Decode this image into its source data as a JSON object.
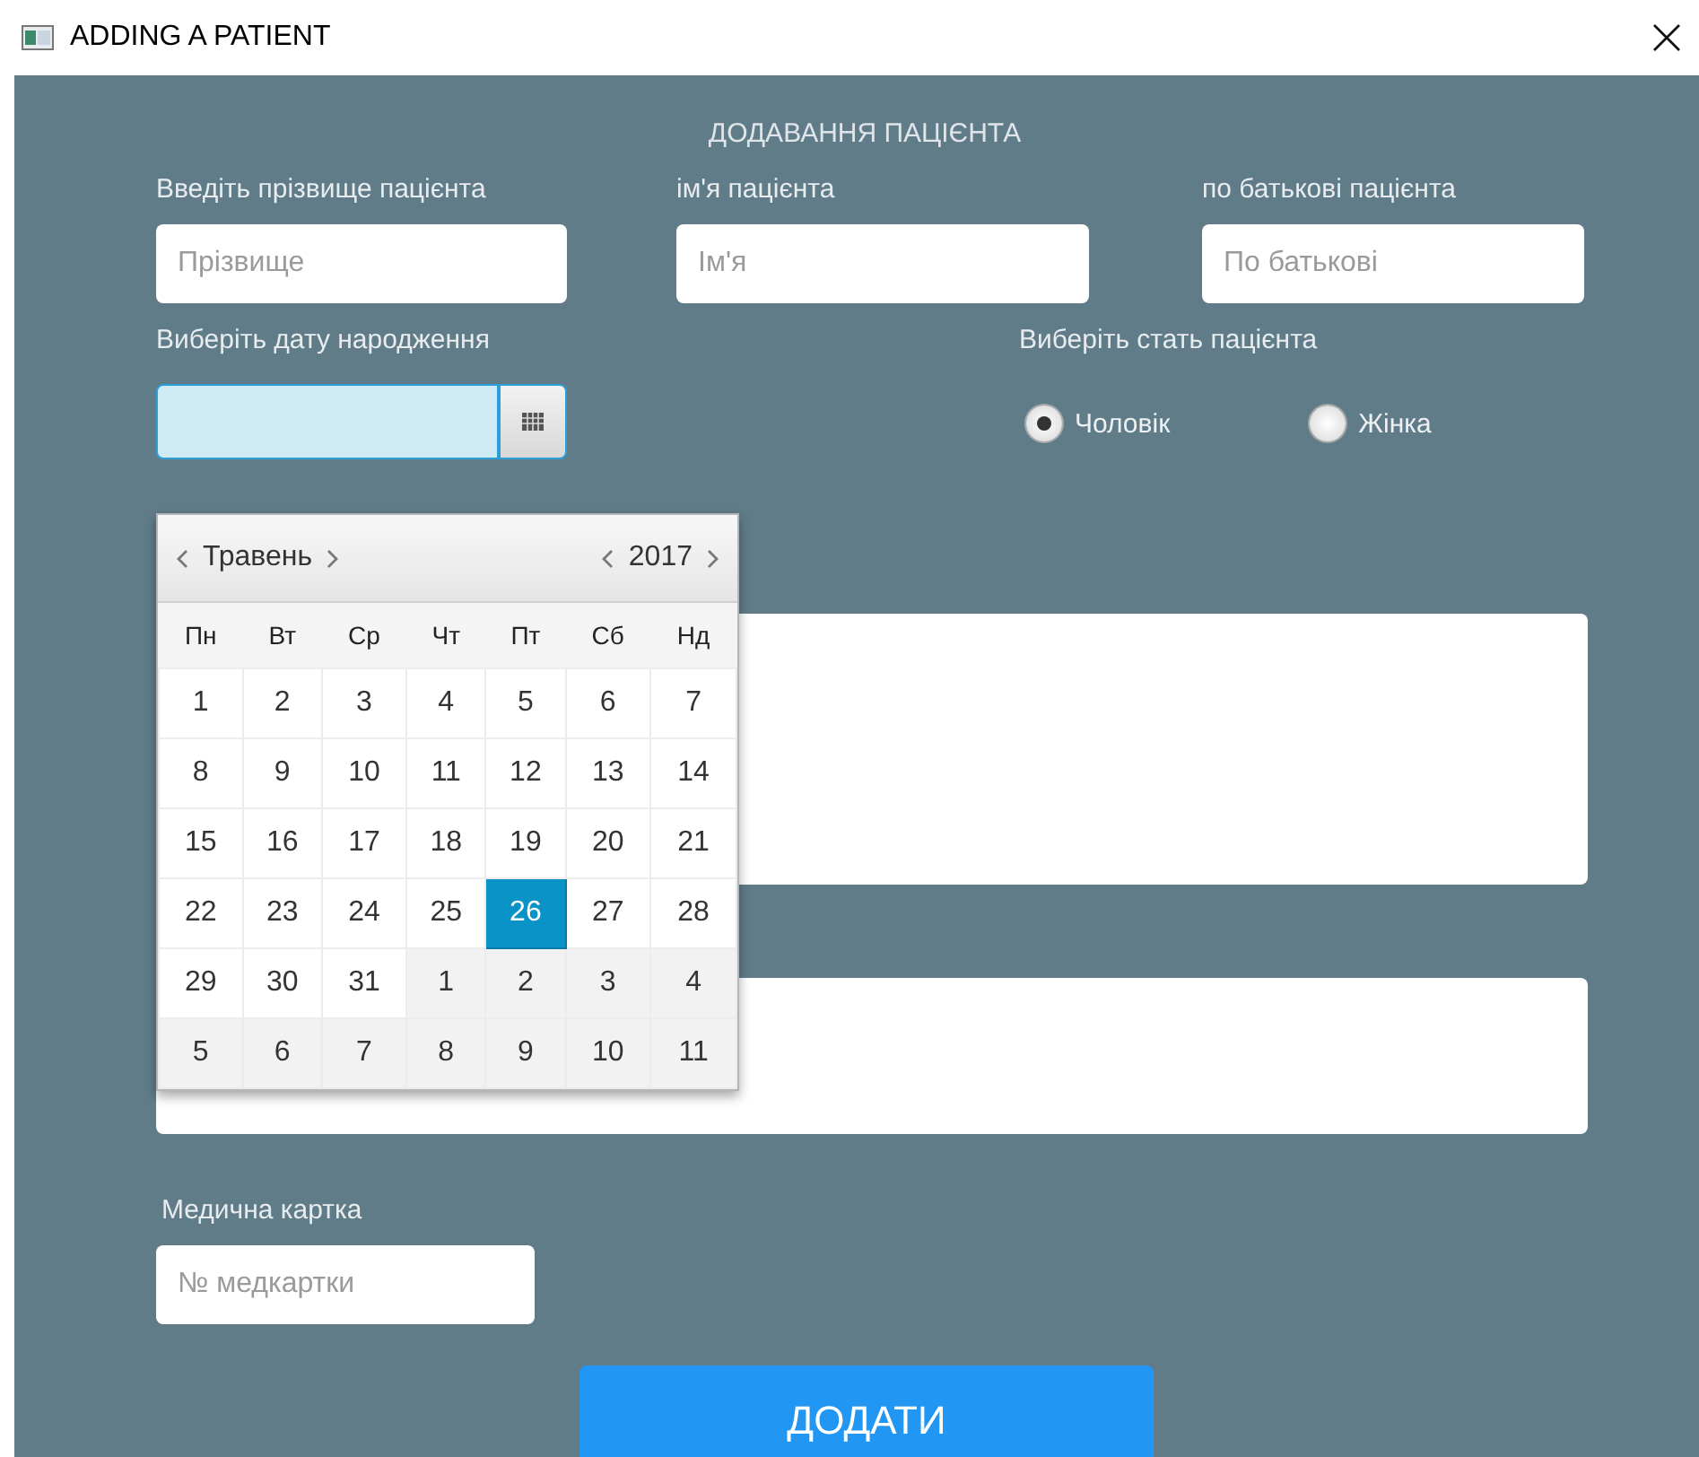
{
  "window": {
    "title": "ADDING A PATIENT"
  },
  "form": {
    "heading": "ДОДАВАННЯ ПАЦІЄНТА",
    "name_fields": [
      {
        "label": "Введіть прізвище пацієнта",
        "placeholder": "Прізвище"
      },
      {
        "label": "ім'я пацієнта",
        "placeholder": "Ім'я"
      },
      {
        "label": "по батькові пацієнта",
        "placeholder": "По батькові"
      }
    ],
    "birth_date": {
      "label": "Виберіть дату народження",
      "focused": true
    },
    "gender": {
      "label": "Виберіть стать пацієнта",
      "options": [
        {
          "label": "Чоловік",
          "selected": true
        },
        {
          "label": "Жінка",
          "selected": false
        }
      ]
    },
    "medical_card": {
      "label": "Медична картка",
      "placeholder": "№ медкартки"
    },
    "submit": "ДОДАТИ"
  },
  "calendar": {
    "month": "Травень",
    "year": "2017",
    "weekdays": [
      "Пн",
      "Вт",
      "Ср",
      "Чт",
      "Пт",
      "Сб",
      "Нд"
    ],
    "weeks": [
      [
        {
          "day": "1",
          "other_month": false,
          "selected": false
        },
        {
          "day": "2",
          "other_month": false,
          "selected": false
        },
        {
          "day": "3",
          "other_month": false,
          "selected": false
        },
        {
          "day": "4",
          "other_month": false,
          "selected": false
        },
        {
          "day": "5",
          "other_month": false,
          "selected": false
        },
        {
          "day": "6",
          "other_month": false,
          "selected": false
        },
        {
          "day": "7",
          "other_month": false,
          "selected": false
        }
      ],
      [
        {
          "day": "8",
          "other_month": false,
          "selected": false
        },
        {
          "day": "9",
          "other_month": false,
          "selected": false
        },
        {
          "day": "10",
          "other_month": false,
          "selected": false
        },
        {
          "day": "11",
          "other_month": false,
          "selected": false
        },
        {
          "day": "12",
          "other_month": false,
          "selected": false
        },
        {
          "day": "13",
          "other_month": false,
          "selected": false
        },
        {
          "day": "14",
          "other_month": false,
          "selected": false
        }
      ],
      [
        {
          "day": "15",
          "other_month": false,
          "selected": false
        },
        {
          "day": "16",
          "other_month": false,
          "selected": false
        },
        {
          "day": "17",
          "other_month": false,
          "selected": false
        },
        {
          "day": "18",
          "other_month": false,
          "selected": false
        },
        {
          "day": "19",
          "other_month": false,
          "selected": false
        },
        {
          "day": "20",
          "other_month": false,
          "selected": false
        },
        {
          "day": "21",
          "other_month": false,
          "selected": false
        }
      ],
      [
        {
          "day": "22",
          "other_month": false,
          "selected": false
        },
        {
          "day": "23",
          "other_month": false,
          "selected": false
        },
        {
          "day": "24",
          "other_month": false,
          "selected": false
        },
        {
          "day": "25",
          "other_month": false,
          "selected": false
        },
        {
          "day": "26",
          "other_month": false,
          "selected": true
        },
        {
          "day": "27",
          "other_month": false,
          "selected": false
        },
        {
          "day": "28",
          "other_month": false,
          "selected": false
        }
      ],
      [
        {
          "day": "29",
          "other_month": false,
          "selected": false
        },
        {
          "day": "30",
          "other_month": false,
          "selected": false
        },
        {
          "day": "31",
          "other_month": false,
          "selected": false
        },
        {
          "day": "1",
          "other_month": true,
          "selected": false
        },
        {
          "day": "2",
          "other_month": true,
          "selected": false
        },
        {
          "day": "3",
          "other_month": true,
          "selected": false
        },
        {
          "day": "4",
          "other_month": true,
          "selected": false
        }
      ],
      [
        {
          "day": "5",
          "other_month": true,
          "selected": false
        },
        {
          "day": "6",
          "other_month": true,
          "selected": false
        },
        {
          "day": "7",
          "other_month": true,
          "selected": false
        },
        {
          "day": "8",
          "other_month": true,
          "selected": false
        },
        {
          "day": "9",
          "other_month": true,
          "selected": false
        },
        {
          "day": "10",
          "other_month": true,
          "selected": false
        },
        {
          "day": "11",
          "other_month": true,
          "selected": false
        }
      ]
    ]
  }
}
